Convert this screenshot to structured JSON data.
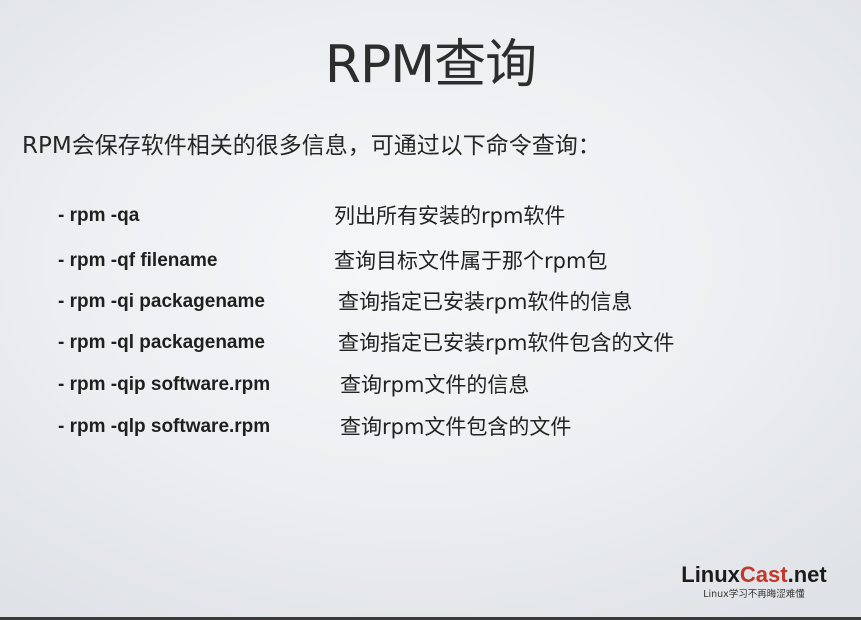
{
  "slide": {
    "title": "RPM查询",
    "intro": "RPM会保存软件相关的很多信息，可通过以下命令查询："
  },
  "commands": [
    {
      "cmd": "- rpm -qa",
      "desc": "列出所有安装的rpm软件"
    },
    {
      "cmd": "- rpm -qf filename",
      "desc": "查询目标文件属于那个rpm包"
    },
    {
      "cmd": "- rpm -qi packagename",
      "desc": "查询指定已安装rpm软件的信息"
    },
    {
      "cmd": "- rpm -ql packagename",
      "desc": "查询指定已安装rpm软件包含的文件"
    },
    {
      "cmd": "- rpm -qip  software.rpm",
      "desc": "查询rpm文件的信息"
    },
    {
      "cmd": "- rpm -qlp  software.rpm",
      "desc": "查询rpm文件包含的文件"
    }
  ],
  "logo": {
    "part_a": "Linux",
    "part_b": "Cast",
    "part_c": ".net",
    "tagline": "Linux学习不再晦涩难懂",
    "accent_color": "#c0392b"
  }
}
